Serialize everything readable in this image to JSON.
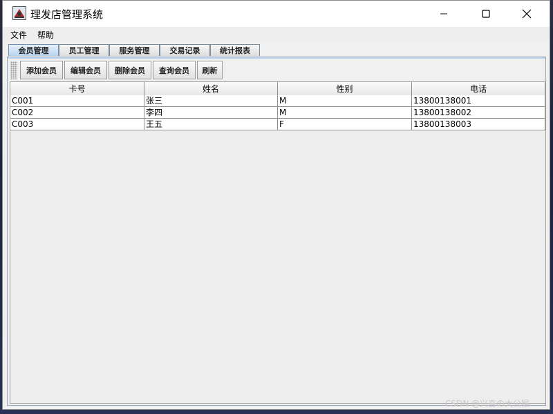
{
  "window": {
    "title": "理发店管理系统"
  },
  "menu": {
    "items": [
      "文件",
      "帮助"
    ]
  },
  "tabs": [
    {
      "label": "会员管理",
      "active": true
    },
    {
      "label": "员工管理",
      "active": false
    },
    {
      "label": "服务管理",
      "active": false
    },
    {
      "label": "交易记录",
      "active": false
    },
    {
      "label": "统计报表",
      "active": false
    }
  ],
  "toolbar": {
    "add_label": "添加会员",
    "edit_label": "编辑会员",
    "delete_label": "删除会员",
    "query_label": "查询会员",
    "refresh_label": "刷新"
  },
  "table": {
    "columns": [
      "卡号",
      "姓名",
      "性别",
      "电话"
    ],
    "rows": [
      [
        "C001",
        "张三",
        "M",
        "13800138001"
      ],
      [
        "C002",
        "李四",
        "M",
        "13800138002"
      ],
      [
        "C003",
        "王五",
        "F",
        "13800138003"
      ]
    ]
  },
  "watermark": "CSDN @兴奋の大公猴",
  "colors": {
    "active_tab": "#b9d3ee",
    "background": "#f0f0f0"
  }
}
